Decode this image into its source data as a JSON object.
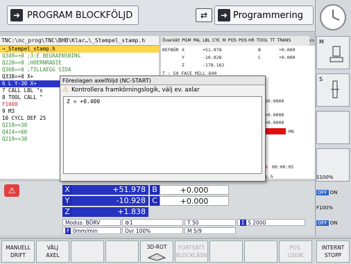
{
  "header": {
    "mode_label": "PROGRAM BLOCKFÖLJD",
    "prog_label": "Programmering"
  },
  "program": {
    "path": "TNC:\\nc_prog\\TNC\\BHB\\Klar…\\_Stempel_stamp.h",
    "lines": [
      "→_Stempel_stamp.h",
      "   Q349=+0      ;3:E BEGRAENSNING",
      "   Q220=+0      ;HOERNRADIE",
      "   Q368=+0      ;TILLAEGG SIDA",
      "   Q338=+0      X+",
      "6  L  Y-30  X+",
      "7  CALL LBL \"s",
      "8  TOOL CALL \"",
      "   F1000",
      "9  M3",
      "10 CYCL DEF 25",
      "   Q218=+30",
      "   Q424=+60",
      "   Q219=+30"
    ]
  },
  "status": {
    "tabs": [
      "Översikt",
      "PGM",
      "PAL",
      "LBL",
      "CYC",
      "M",
      "POS",
      "POS HR",
      "TOOL",
      "TT",
      "TRANS"
    ],
    "ref_label": "REFBÖR",
    "rows": [
      {
        "ax": "X",
        "val": "+51.978",
        "ax2": "B",
        "val2": "+0.000"
      },
      {
        "ax": "Y",
        "val": "-10.928",
        "ax2": "C",
        "val2": "+0.000"
      },
      {
        "ax": "Z",
        "val": "-178.162",
        "ax2": "",
        "val2": ""
      }
    ],
    "tool_line": "T : 50     FACE MILL D40",
    "val_a": "20.0000",
    "val_b": "+0.0000",
    "val_c": "+0.0000",
    "m_label": "M9",
    "time": "00:00:05",
    "file": "p.h"
  },
  "dialog": {
    "title": "Föreslagen axelföljd (NC-START)",
    "warning": "Kontrollera framkörningslogik, välj ev. axlar",
    "entry": "Z =        +0.400"
  },
  "positions": {
    "axes": [
      {
        "axis": "X",
        "value": "+51.978",
        "axis2": "B",
        "value2": "+0.000"
      },
      {
        "axis": "Y",
        "value": "-10.928",
        "axis2": "C",
        "value2": "+0.000"
      },
      {
        "axis": "Z",
        "value": "+1.838",
        "axis2": "",
        "value2": ""
      }
    ],
    "mode": "Modus: BÖRV",
    "tool": "T 50",
    "spindle": "S 2000",
    "feed": "0mm/min",
    "ovr": "Ovr 100%",
    "m": "M 5/9"
  },
  "side": {
    "m_label": "M",
    "s_label": "S",
    "s100": "S100%",
    "f100": "F100%",
    "off1": "OFF",
    "on1": "ON",
    "off2": "OFF",
    "on2": "ON"
  },
  "softkeys": [
    {
      "l1": "MANUELL",
      "l2": "DRIFT",
      "enabled": true
    },
    {
      "l1": "VÄLJ",
      "l2": "AXEL",
      "enabled": true
    },
    {
      "l1": "",
      "l2": "",
      "enabled": true
    },
    {
      "l1": "",
      "l2": "",
      "enabled": true
    },
    {
      "l1": "3D-ROT",
      "l2": "",
      "enabled": true
    },
    {
      "l1": "FORTSÄTT",
      "l2": "BLOCKLÄSN",
      "enabled": false
    },
    {
      "l1": "",
      "l2": "",
      "enabled": true
    },
    {
      "l1": "",
      "l2": "",
      "enabled": true
    },
    {
      "l1": "POS.",
      "l2": "LOGIK",
      "enabled": false
    },
    {
      "l1": "INTERNT",
      "l2": "STOPP",
      "enabled": true
    }
  ]
}
